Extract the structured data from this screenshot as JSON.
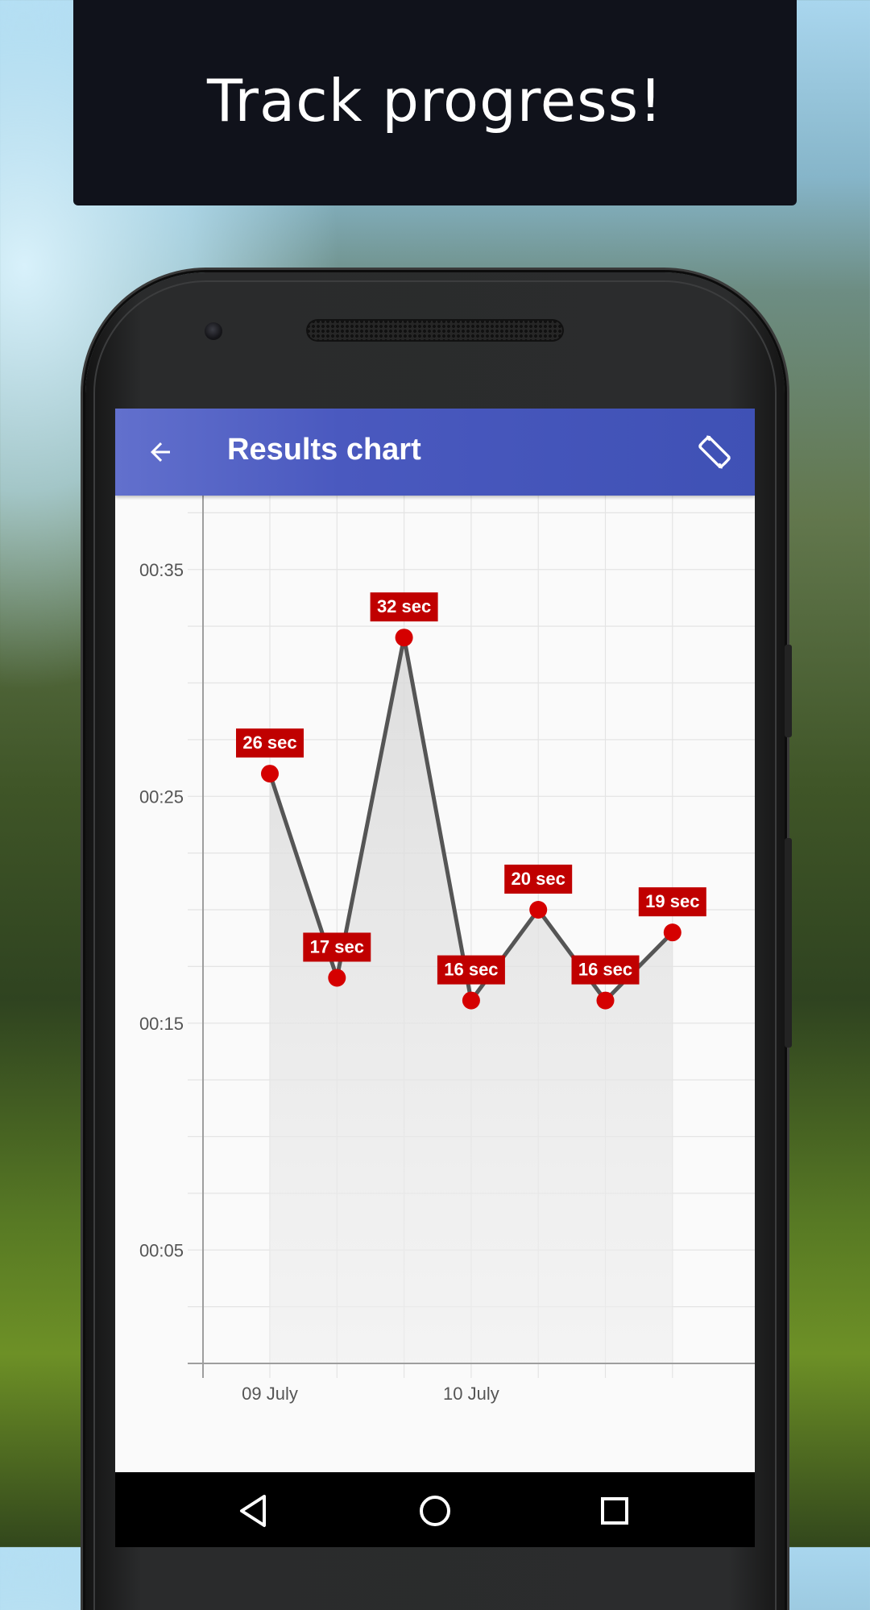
{
  "banner": {
    "text": "Track progress!"
  },
  "app_bar": {
    "title": "Results chart",
    "back_icon": "arrow-left-icon",
    "rotate_icon": "screen-rotation-icon",
    "color": "#3f51b5"
  },
  "nav_bar": {
    "back_icon": "triangle-back-icon",
    "home_icon": "circle-home-icon",
    "recents_icon": "square-recents-icon"
  },
  "chart_data": {
    "type": "line",
    "x": [
      "09 July",
      "",
      "",
      "10 July",
      "",
      "",
      ""
    ],
    "x_tick_labels": [
      "09 July",
      "10 July"
    ],
    "values": [
      26,
      17,
      32,
      16,
      20,
      16,
      19
    ],
    "data_labels": [
      "26 sec",
      "17 sec",
      "32 sec",
      "16 sec",
      "20 sec",
      "16 sec",
      "19 sec"
    ],
    "y_tick_labels": [
      "00:05",
      "00:15",
      "00:25",
      "00:35"
    ],
    "y_ticks": [
      5,
      15,
      25,
      35
    ],
    "ylim": [
      0,
      40
    ],
    "grid": true,
    "area_fill": true,
    "line_color": "#555555",
    "point_color": "#d50000",
    "label_bg_color": "#c00000"
  }
}
